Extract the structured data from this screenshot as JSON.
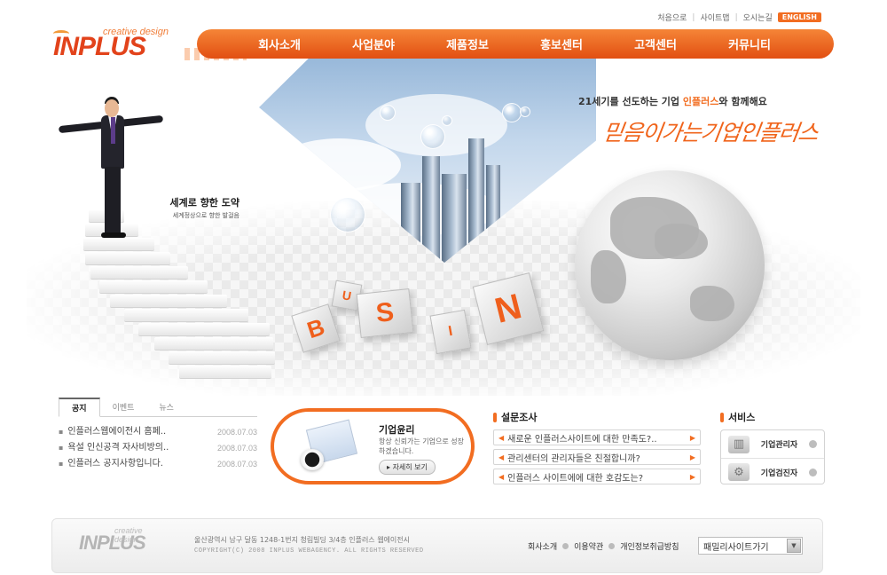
{
  "logo": {
    "main": "INPLUS",
    "sub": "creative design"
  },
  "util_links": {
    "login": "처음으로",
    "sitemap": "사이트맵",
    "directions": "오시는길",
    "english": "ENGLISH"
  },
  "nav": {
    "items": [
      "회사소개",
      "사업분야",
      "제품정보",
      "홍보센터",
      "고객센터",
      "커뮤니티"
    ]
  },
  "hero": {
    "tag_title": "세계로 향한 도약",
    "tag_sub": "세계정상으로 향한 발걸음",
    "slogan_prefix": "21세기를 선도하는 기업 ",
    "slogan_brand": "인플러스",
    "slogan_suffix": "와 함께해요",
    "script": "믿음이가는기업인플러스",
    "cubes": [
      "B",
      "U",
      "S",
      "I",
      "N"
    ]
  },
  "notice": {
    "tabs": [
      "공지",
      "이벤트",
      "뉴스"
    ],
    "items": [
      {
        "title": "인플러스웹에이전시 홈페..",
        "date": "2008.07.03"
      },
      {
        "title": "욕설 인신공격 자사비방의..",
        "date": "2008.07.03"
      },
      {
        "title": "인플러스 공지사항입니다.",
        "date": "2008.07.03"
      }
    ]
  },
  "ethics": {
    "title": "기업윤리",
    "desc": "항상 신뢰가는 기업으로 성장하겠습니다.",
    "more": "자세히 보기"
  },
  "survey": {
    "title": "설문조사",
    "items": [
      "새로운 인플러스사이트에 대한 만족도?..",
      "관리센터의 관리자들은 친절합니까?",
      "인플러스 사이트에에 대한 호감도는?"
    ]
  },
  "service": {
    "title": "서비스",
    "items": [
      {
        "label": "기업관리자",
        "icon": "chart-icon"
      },
      {
        "label": "기업검진자",
        "icon": "gears-icon"
      }
    ]
  },
  "footer": {
    "logo_main": "INPLUS",
    "logo_sub": "creative design",
    "address": "울산광역시 남구 달동 1248-1번지 청림빌딩 3/4층 인플러스 웹에이전시",
    "copyright": "COPYRIGHT(C) 2008 INPLUS WEBAGENCY. ALL RIGHTS RESERVED",
    "links": [
      "회사소개",
      "이용약관",
      "개인정보취급방침"
    ],
    "family_site": "패밀리사이트가기"
  },
  "colors": {
    "accent": "#f26d21",
    "nav_gradient_top": "#f58537",
    "nav_gradient_bottom": "#e24f12"
  }
}
